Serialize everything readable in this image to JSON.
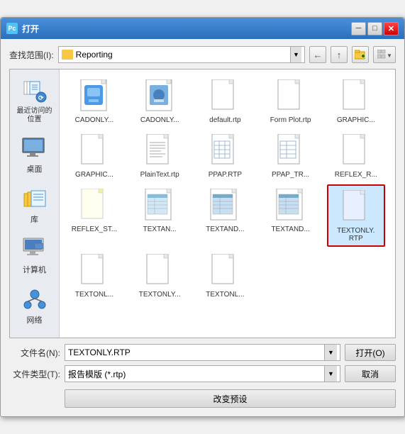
{
  "titlebar": {
    "icon": "Pc",
    "title": "打开",
    "minimize_label": "─",
    "maximize_label": "□",
    "close_label": "✕"
  },
  "location_bar": {
    "label": "查找范围(I):",
    "current_folder": "Reporting",
    "arrow": "▼"
  },
  "nav_buttons": {
    "back": "←",
    "up": "↑",
    "new_folder": "📁",
    "view": "▦▼"
  },
  "sidebar": {
    "items": [
      {
        "id": "recent",
        "label": "最近访问的位置",
        "icon": "clock"
      },
      {
        "id": "desktop",
        "label": "桌面",
        "icon": "desktop"
      },
      {
        "id": "library",
        "label": "库",
        "icon": "library"
      },
      {
        "id": "computer",
        "label": "计算机",
        "icon": "computer"
      },
      {
        "id": "network",
        "label": "网络",
        "icon": "network"
      }
    ]
  },
  "files": [
    {
      "id": 1,
      "name": "CADONLY...",
      "type": "phone-blue",
      "selected": false
    },
    {
      "id": 2,
      "name": "CADONLY...",
      "type": "phone-blue2",
      "selected": false
    },
    {
      "id": 3,
      "name": "default.rtp",
      "type": "doc-plain",
      "selected": false
    },
    {
      "id": 4,
      "name": "Form Plot.rtp",
      "type": "doc-plain",
      "selected": false
    },
    {
      "id": 5,
      "name": "GRAPHIC...",
      "type": "doc-plain",
      "selected": false
    },
    {
      "id": 6,
      "name": "GRAPHIC...",
      "type": "doc-plain",
      "selected": false
    },
    {
      "id": 7,
      "name": "PlainText.rtp",
      "type": "doc-lines",
      "selected": false
    },
    {
      "id": 8,
      "name": "PPAP.RTP",
      "type": "doc-grid",
      "selected": false
    },
    {
      "id": 9,
      "name": "PPAP_TR...",
      "type": "doc-grid2",
      "selected": false
    },
    {
      "id": 10,
      "name": "REFLEX_R...",
      "type": "doc-plain",
      "selected": false
    },
    {
      "id": 11,
      "name": "REFLEX_ST...",
      "type": "doc-yellow",
      "selected": false
    },
    {
      "id": 12,
      "name": "TEXTAN...",
      "type": "doc-blue-detail",
      "selected": false
    },
    {
      "id": 13,
      "name": "TEXTAND...",
      "type": "doc-blue-detail",
      "selected": false
    },
    {
      "id": 14,
      "name": "TEXTAND...",
      "type": "doc-blue-detail",
      "selected": false
    },
    {
      "id": 15,
      "name": "TEXTONLY.\nRTP",
      "type": "doc-plain-selected",
      "selected": true
    },
    {
      "id": 16,
      "name": "TEXTONL...",
      "type": "doc-plain",
      "selected": false
    },
    {
      "id": 17,
      "name": "TEXTONLY...",
      "type": "doc-plain",
      "selected": false
    },
    {
      "id": 18,
      "name": "TEXTONL...",
      "type": "doc-plain",
      "selected": false
    }
  ],
  "bottom_form": {
    "filename_label": "文件名(N):",
    "filename_value": "TEXTONLY.RTP",
    "filetype_label": "文件类型(T):",
    "filetype_value": "报告模版 (*.rtp)",
    "open_button": "打开(O)",
    "cancel_button": "取消",
    "change_button": "改变预设"
  }
}
